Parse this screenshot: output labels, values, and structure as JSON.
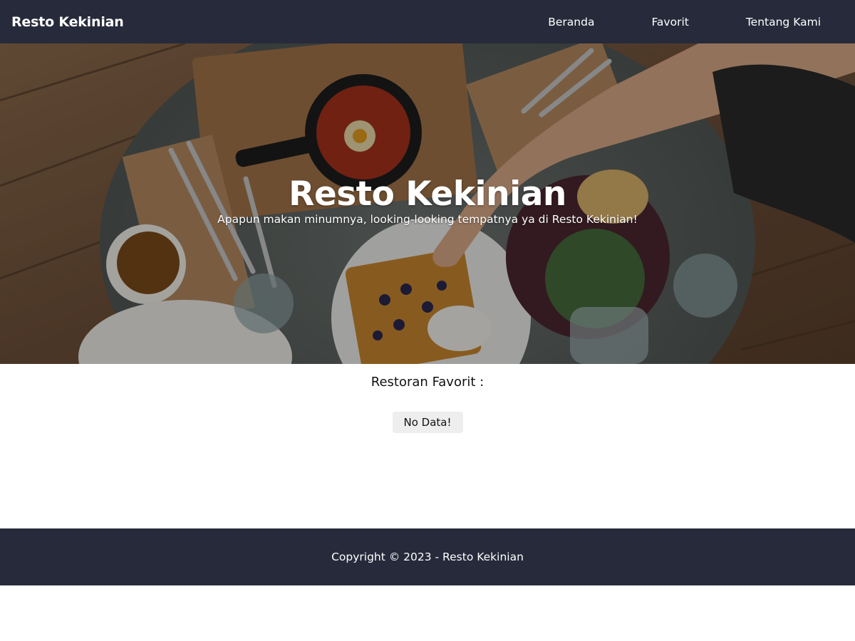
{
  "navbar": {
    "brand": "Resto Kekinian",
    "links": [
      "Beranda",
      "Favorit",
      "Tentang Kami"
    ]
  },
  "hero": {
    "title": "Resto Kekinian",
    "tagline": "Apapun makan minumnya, looking-looking tempatnya ya di Resto Kekinian!",
    "image_description": "top-down photo of a restaurant table with waffles, shakshuka pan, salad and drinks"
  },
  "favorites": {
    "heading": "Restoran Favorit :",
    "empty_message": "No Data!"
  },
  "footer": {
    "copyright": "Copyright © 2023 - Resto Kekinian"
  },
  "colors": {
    "navbar_bg": "#272a3b",
    "footer_bg": "#272a3b",
    "empty_badge_bg": "#eeeeee"
  }
}
